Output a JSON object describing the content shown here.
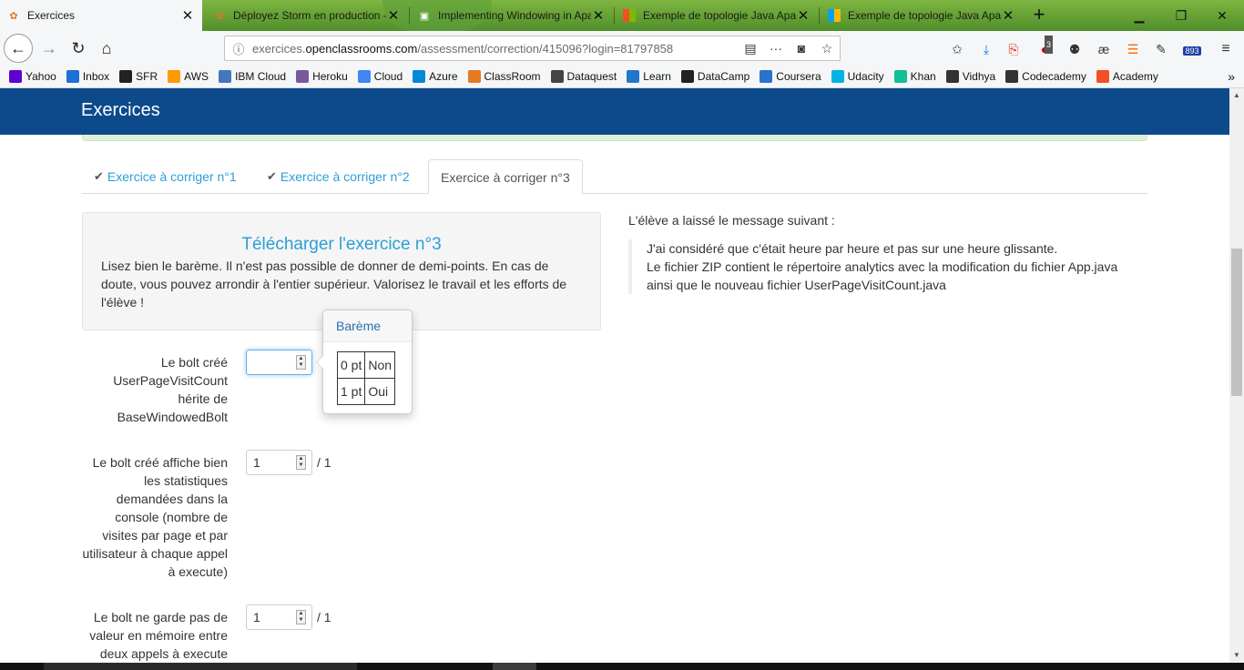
{
  "browser": {
    "tabs": [
      {
        "title": "Exercices",
        "active": true,
        "icon": "openclassrooms-icon"
      },
      {
        "title": "Déployez Storm en production - Ope",
        "active": false,
        "icon": "openclassrooms-icon"
      },
      {
        "title": "Implementing Windowing in Apache",
        "active": false,
        "icon": "apache-icon"
      },
      {
        "title": "Exemple de topologie Java Apache S",
        "active": false,
        "icon": "microsoft-icon"
      },
      {
        "title": "Exemple de topologie Java Apache S",
        "active": false,
        "icon": "microsoft-icon"
      }
    ],
    "url_prefix": "exercices.",
    "url_domain": "openclassrooms.com",
    "url_path": "/assessment/correction/415096?login=81797858",
    "addon_badge": "3",
    "counter_badge": "893",
    "bookmarks": [
      {
        "label": "Yahoo",
        "color": "#5f01d1"
      },
      {
        "label": "Inbox",
        "color": "#1f6fd6"
      },
      {
        "label": "SFR",
        "color": "#222222"
      },
      {
        "label": "AWS",
        "color": "#ff9900"
      },
      {
        "label": "IBM Cloud",
        "color": "#4178be"
      },
      {
        "label": "Heroku",
        "color": "#79589f"
      },
      {
        "label": "Cloud",
        "color": "#4285f4"
      },
      {
        "label": "Azure",
        "color": "#0089d6"
      },
      {
        "label": "ClassRoom",
        "color": "#e57a20"
      },
      {
        "label": "Dataquest",
        "color": "#444444"
      },
      {
        "label": "Learn",
        "color": "#2277cc"
      },
      {
        "label": "DataCamp",
        "color": "#222222"
      },
      {
        "label": "Coursera",
        "color": "#2a73cc"
      },
      {
        "label": "Udacity",
        "color": "#02b3e4"
      },
      {
        "label": "Khan",
        "color": "#14bf96"
      },
      {
        "label": "Vidhya",
        "color": "#333333"
      },
      {
        "label": "Codecademy",
        "color": "#333333"
      },
      {
        "label": "Academy",
        "color": "#f25022"
      }
    ]
  },
  "page": {
    "brand": "Exercices",
    "tabs": [
      {
        "label": "Exercice à corriger n°1",
        "checked": true
      },
      {
        "label": "Exercice à corriger n°2",
        "checked": true
      },
      {
        "label": "Exercice à corriger n°3",
        "checked": false
      }
    ],
    "download_title": "Télécharger l'exercice n°3",
    "download_text": "Lisez bien le barème. Il n'est pas possible de donner de demi-points. En cas de doute, vous pouvez arrondir à l'entier supérieur. Valorisez le travail et les efforts de l'élève !",
    "message_label": "L'élève a laissé le message suivant :",
    "message_lines": [
      "J'ai considéré que c'était heure par heure et pas sur une heure glissante.",
      "Le fichier ZIP contient le répertoire analytics avec la modification du fichier App.java",
      "ainsi que le nouveau fichier UserPageVisitCount.java"
    ],
    "criteria": [
      {
        "label": "Le bolt créé UserPageVisitCount hérite de BaseWindowedBolt",
        "value": "",
        "out_of": ""
      },
      {
        "label": "Le bolt créé affiche bien les statistiques demandées dans la console (nombre de visites par page et par utilisateur à chaque appel à execute)",
        "value": "1",
        "out_of": "/ 1"
      },
      {
        "label": "Le bolt ne garde pas de valeur en mémoire entre deux appels à execute",
        "value": "1",
        "out_of": "/ 1"
      }
    ],
    "bareme": {
      "title": "Barème",
      "rows": [
        {
          "points": "0 pt",
          "answer": "Non"
        },
        {
          "points": "1 pt",
          "answer": "Oui"
        }
      ]
    }
  }
}
